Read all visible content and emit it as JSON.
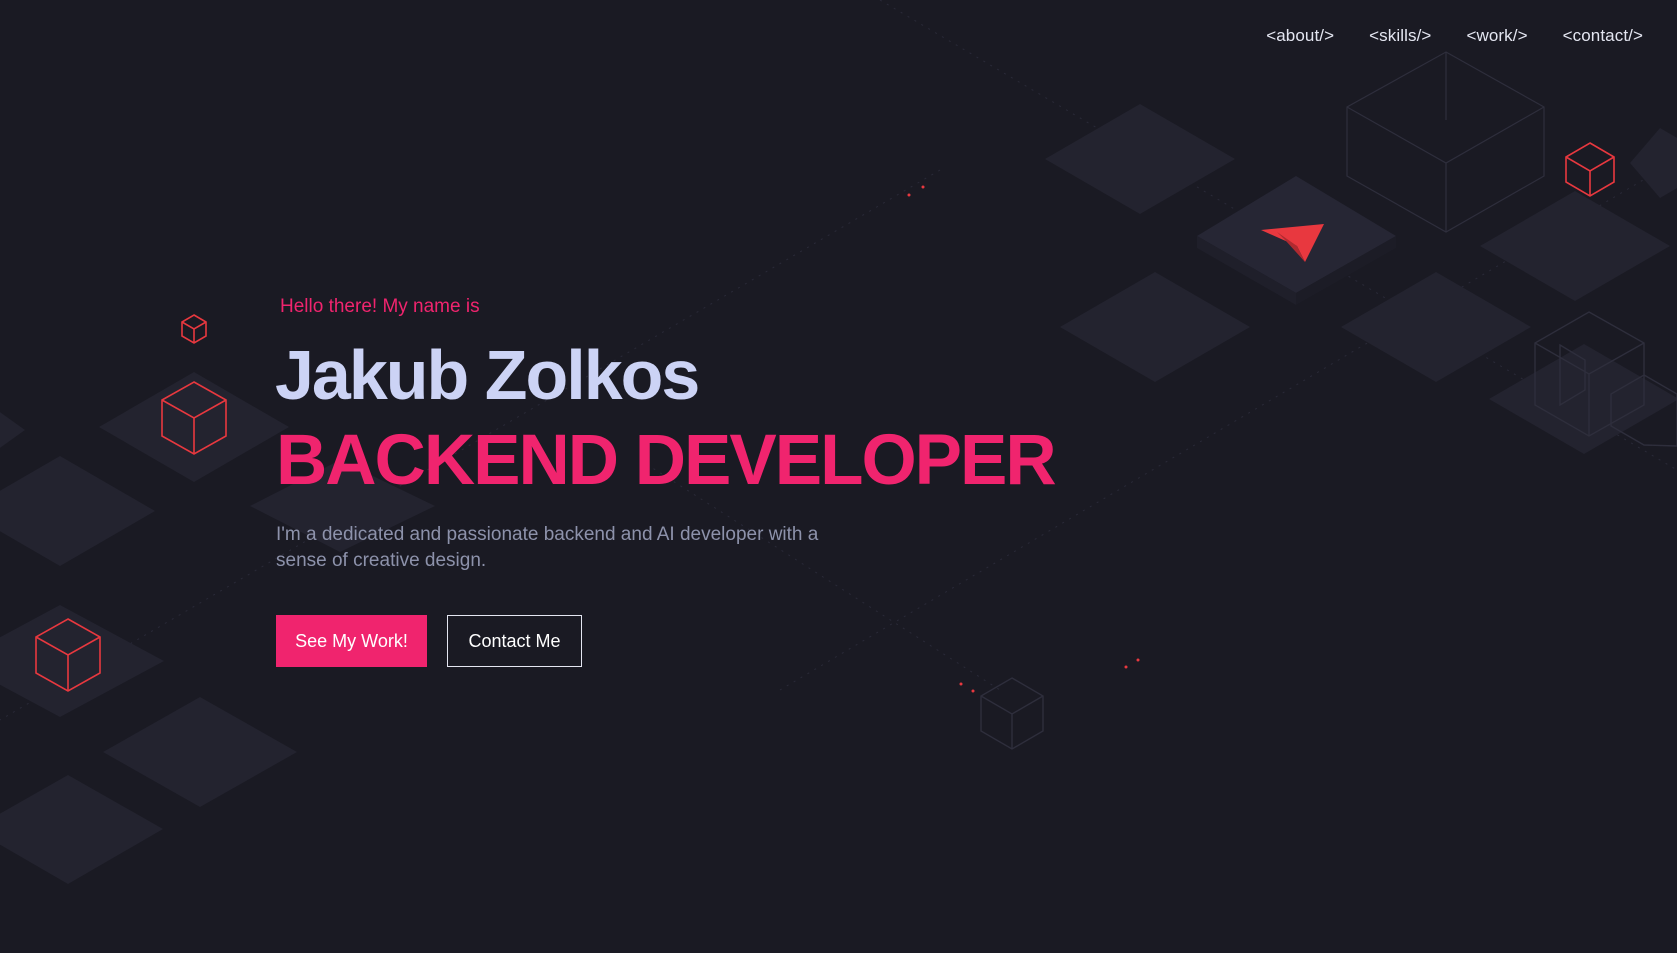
{
  "nav": {
    "items": [
      {
        "label": "<about/>"
      },
      {
        "label": "<skills/>"
      },
      {
        "label": "<work/>"
      },
      {
        "label": "<contact/>"
      }
    ]
  },
  "hero": {
    "greeting": "Hello there! My name is",
    "name": "Jakub Zolkos",
    "role": "BACKEND DEVELOPER",
    "description": "I'm a dedicated and passionate backend and AI developer with a sense of creative design.",
    "primary_button": "See My Work!",
    "secondary_button": "Contact Me"
  },
  "colors": {
    "background": "#1a1a23",
    "accent": "#f0246e",
    "name_text": "#ccd3f5",
    "tile": "#22222e",
    "cube_outline": "#e8383f"
  },
  "icons": [
    "cube-icon",
    "paper-plane-icon"
  ]
}
